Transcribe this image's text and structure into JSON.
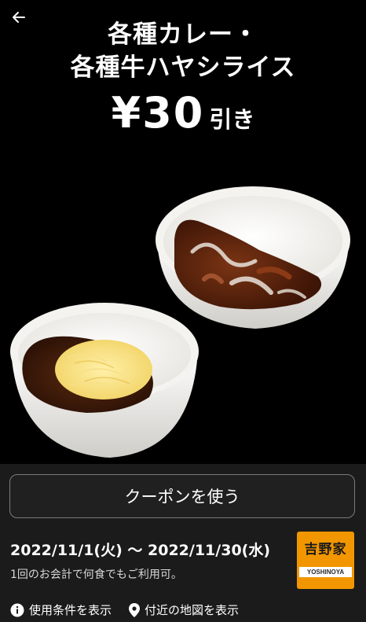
{
  "header": {
    "back_icon": "arrow-left-icon",
    "title_line1": "各種カレー・",
    "title_line2": "各種牛ハヤシライス",
    "price": "¥30",
    "discount_suffix": "引き"
  },
  "coupon": {
    "use_button_label": "クーポンを使う",
    "validity": "2022/11/1(火) 〜 2022/11/30(水)",
    "note": "1回のお会計で何食でもご利用可。"
  },
  "brand": {
    "logo_kanji": "吉野家",
    "logo_text": "YOSHINOYA",
    "color": "#f29600"
  },
  "links": {
    "conditions_label": "使用条件を表示",
    "conditions_icon": "info-icon",
    "map_label": "付近の地図を表示",
    "map_icon": "location-pin-icon"
  }
}
